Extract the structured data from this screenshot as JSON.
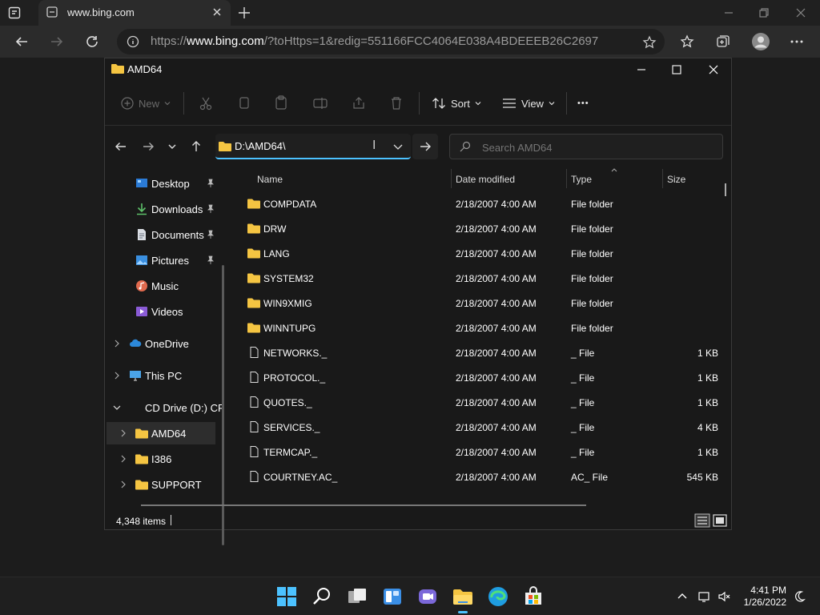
{
  "browser": {
    "tab_title": "www.bing.com",
    "url_prefix": "https://",
    "url_host": "www.bing.com",
    "url_rest": "/?toHttps=1&redig=551166FCC4064E038A4BDEEEB26C2697"
  },
  "explorer": {
    "title": "AMD64",
    "commands": {
      "new": "New",
      "sort": "Sort",
      "view": "View",
      "more": "•••"
    },
    "path": "D:\\AMD64\\",
    "search_placeholder": "Search AMD64",
    "nav": {
      "quick_access": [
        {
          "label": "Desktop"
        },
        {
          "label": "Downloads"
        },
        {
          "label": "Documents"
        },
        {
          "label": "Pictures"
        },
        {
          "label": "Music"
        },
        {
          "label": "Videos"
        }
      ],
      "onedrive": "OneDrive",
      "thispc": "This PC",
      "cddrive": "CD Drive (D:) CRI",
      "children": [
        "AMD64",
        "I386",
        "SUPPORT"
      ]
    },
    "columns": {
      "name": "Name",
      "date": "Date modified",
      "type": "Type",
      "size": "Size"
    },
    "files": [
      {
        "name": "COMPDATA",
        "date": "2/18/2007 4:00 AM",
        "type": "File folder",
        "size": "",
        "kind": "folder"
      },
      {
        "name": "DRW",
        "date": "2/18/2007 4:00 AM",
        "type": "File folder",
        "size": "",
        "kind": "folder"
      },
      {
        "name": "LANG",
        "date": "2/18/2007 4:00 AM",
        "type": "File folder",
        "size": "",
        "kind": "folder"
      },
      {
        "name": "SYSTEM32",
        "date": "2/18/2007 4:00 AM",
        "type": "File folder",
        "size": "",
        "kind": "folder"
      },
      {
        "name": "WIN9XMIG",
        "date": "2/18/2007 4:00 AM",
        "type": "File folder",
        "size": "",
        "kind": "folder"
      },
      {
        "name": "WINNTUPG",
        "date": "2/18/2007 4:00 AM",
        "type": "File folder",
        "size": "",
        "kind": "folder"
      },
      {
        "name": "NETWORKS._",
        "date": "2/18/2007 4:00 AM",
        "type": "_ File",
        "size": "1 KB",
        "kind": "file"
      },
      {
        "name": "PROTOCOL._",
        "date": "2/18/2007 4:00 AM",
        "type": "_ File",
        "size": "1 KB",
        "kind": "file"
      },
      {
        "name": "QUOTES._",
        "date": "2/18/2007 4:00 AM",
        "type": "_ File",
        "size": "1 KB",
        "kind": "file"
      },
      {
        "name": "SERVICES._",
        "date": "2/18/2007 4:00 AM",
        "type": "_ File",
        "size": "4 KB",
        "kind": "file"
      },
      {
        "name": "TERMCAP._",
        "date": "2/18/2007 4:00 AM",
        "type": "_ File",
        "size": "1 KB",
        "kind": "file"
      },
      {
        "name": "COURTNEY.AC_",
        "date": "2/18/2007 4:00 AM",
        "type": "AC_ File",
        "size": "545 KB",
        "kind": "file"
      }
    ],
    "status": "4,348 items"
  },
  "taskbar": {
    "time": "4:41 PM",
    "date": "1/26/2022"
  },
  "colors": {
    "accent": "#4cc2ff",
    "folder": "#f5c542"
  }
}
